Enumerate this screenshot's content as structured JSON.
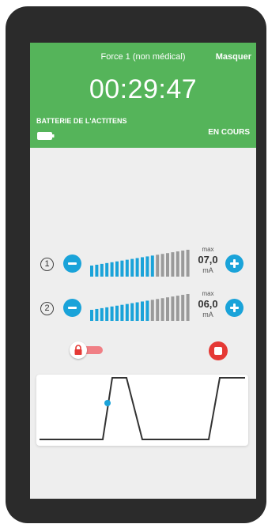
{
  "header": {
    "program_title": "Force 1 (non médical)",
    "hide_label": "Masquer",
    "timer": "00:29:47",
    "battery_label": "BATTERIE DE L'ACTITENS",
    "status": "EN COURS",
    "background_color": "#55b45a"
  },
  "channels": [
    {
      "number": "1",
      "max_label": "max",
      "max_value": "07,0",
      "unit": "mA",
      "total_levels": 20,
      "active_levels": 13
    },
    {
      "number": "2",
      "max_label": "max",
      "max_value": "06,0",
      "unit": "mA",
      "total_levels": 20,
      "active_levels": 12
    }
  ],
  "icons": {
    "minus": "minus-icon",
    "plus": "plus-icon",
    "lock": "lock-icon",
    "stop": "stop-icon",
    "battery": "battery-icon"
  },
  "colors": {
    "accent_blue": "#1aa3d9",
    "inactive_bar": "#9a9a9a",
    "stop_red": "#e53935",
    "lock_red": "#f07f85"
  }
}
